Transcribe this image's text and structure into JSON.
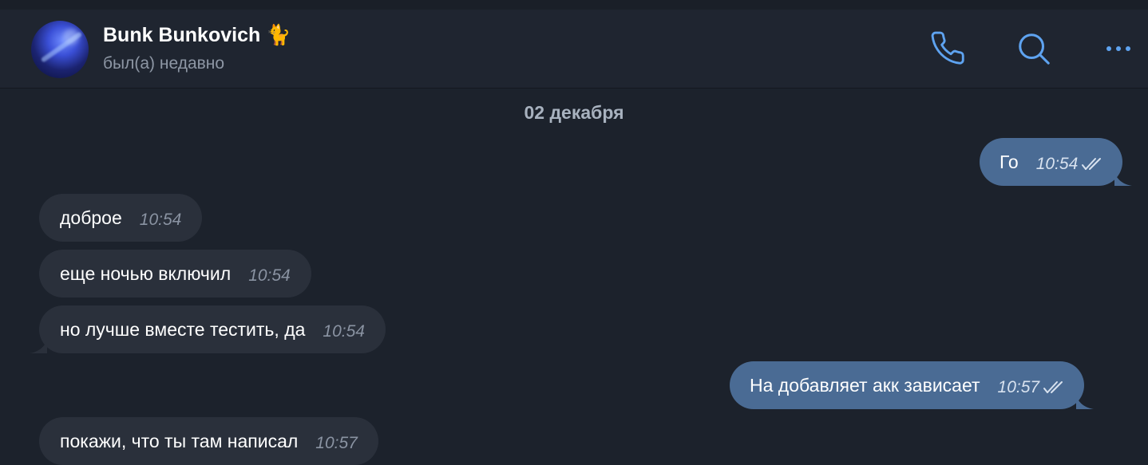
{
  "header": {
    "contact_name": "Bunk Bunkovich",
    "contact_emoji": "🐈",
    "status": "был(а) недавно"
  },
  "icons": {
    "call": "phone-icon",
    "search": "search-icon",
    "more": "more-dots-icon",
    "read": "double-check-icon"
  },
  "colors": {
    "accent": "#5ea3f0",
    "outgoing_bubble": "#4a6b94",
    "incoming_bubble": "#2a303b",
    "background": "#1c222c"
  },
  "chat": {
    "date_separator": "02 декабря",
    "messages": [
      {
        "direction": "out",
        "text": "Го",
        "time": "10:54",
        "read": true
      },
      {
        "direction": "in",
        "text": "доброе",
        "time": "10:54"
      },
      {
        "direction": "in",
        "text": "еще ночью включил",
        "time": "10:54"
      },
      {
        "direction": "in",
        "text": "но лучше вместе тестить, да",
        "time": "10:54"
      },
      {
        "direction": "out",
        "text": "На добавляет акк зависает",
        "time": "10:57",
        "read": true
      },
      {
        "direction": "in",
        "text": "покажи, что ты там написал",
        "time": "10:57"
      }
    ]
  }
}
